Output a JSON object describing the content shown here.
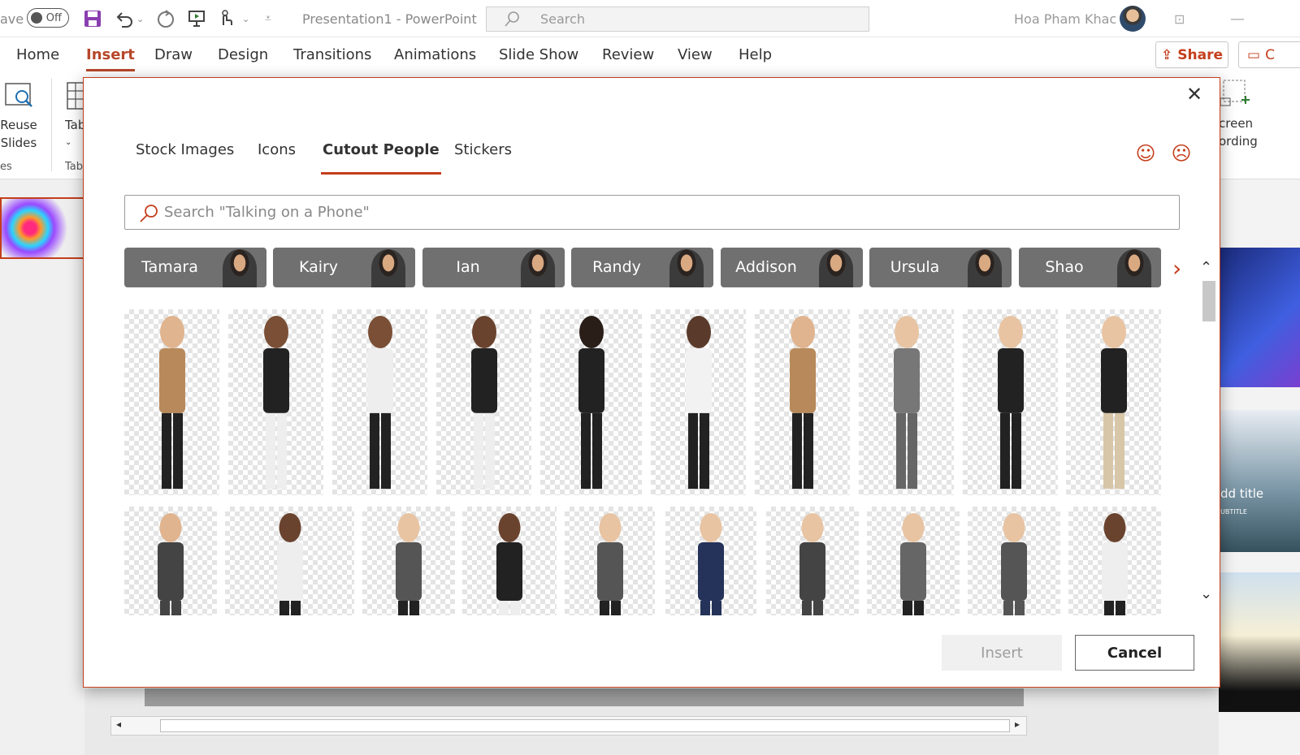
{
  "titlebar": {
    "autosave_label": "ave",
    "autosave_state": "Off",
    "doc_title": "Presentation1  -  PowerPoint",
    "search_placeholder": "Search",
    "user_name": "Hoa Pham Khac"
  },
  "menu": {
    "items": [
      "Home",
      "Insert",
      "Draw",
      "Design",
      "Transitions",
      "Animations",
      "Slide Show",
      "Review",
      "View",
      "Help"
    ],
    "active": "Insert",
    "share_label": "Share",
    "comments_label": "C"
  },
  "ribbon": {
    "reuse_slides_line1": "Reuse",
    "reuse_slides_line2": "Slides",
    "table_label": "Tab",
    "group_slides": "es",
    "group_tables": "Tab",
    "screen_recording_line1": "creen",
    "screen_recording_line2": "ording"
  },
  "right_pane": {
    "thumb_title": "dd title",
    "thumb_subtitle": "UBTITLE"
  },
  "dialog": {
    "tabs": [
      "Stock Images",
      "Icons",
      "Cutout People",
      "Stickers"
    ],
    "active_tab": "Cutout People",
    "search_placeholder": "Search \"Talking on a Phone\"",
    "people": [
      "Tamara",
      "Kairy",
      "Ian",
      "Randy",
      "Addison",
      "Ursula",
      "Shao"
    ],
    "insert_label": "Insert",
    "cancel_label": "Cancel",
    "feedback_icons": [
      "smile-icon",
      "frown-icon"
    ]
  },
  "colors": {
    "accent": "#c43e1c",
    "chip_bg": "#707070"
  }
}
